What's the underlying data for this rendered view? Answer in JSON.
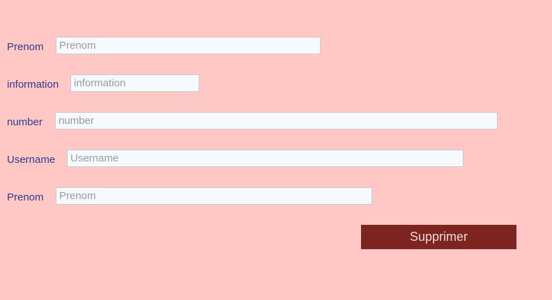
{
  "form": {
    "fields": [
      {
        "label": "Prenom",
        "placeholder": "Prenom",
        "value": ""
      },
      {
        "label": "information",
        "placeholder": "information",
        "value": ""
      },
      {
        "label": "number",
        "placeholder": "number",
        "value": ""
      },
      {
        "label": "Username",
        "placeholder": "Username",
        "value": ""
      },
      {
        "label": "Prenom",
        "placeholder": "Prenom",
        "value": ""
      }
    ],
    "submit_label": "Supprimer"
  },
  "colors": {
    "background": "#ffc8c4",
    "label_text": "#2a3b8f",
    "input_background": "#f4fafd",
    "button_background": "#7c241f",
    "button_text": "#f3d7d4"
  }
}
